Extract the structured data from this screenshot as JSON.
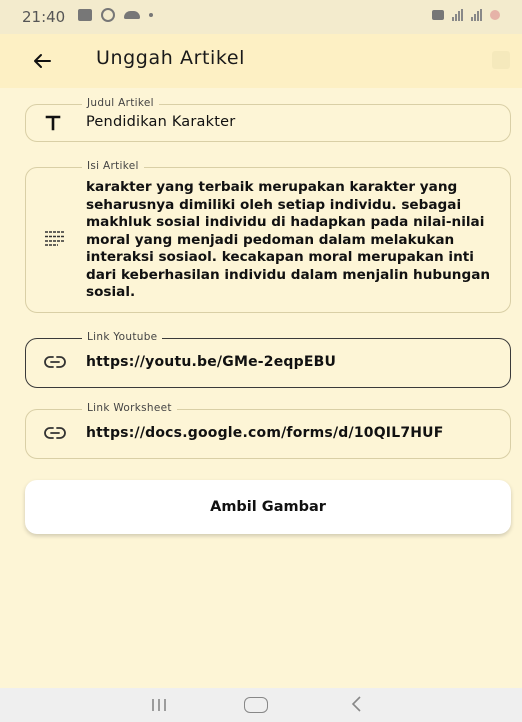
{
  "status_bar": {
    "time": "21:40",
    "icons": [
      "gallery-icon",
      "instagram-icon",
      "cloud-icon",
      "dot-icon",
      "vibrate-icon",
      "signal-icon",
      "signal-icon",
      "battery-icon"
    ]
  },
  "app_bar": {
    "title": "Unggah Artikel",
    "back_icon": "arrow-left-icon"
  },
  "form": {
    "title_field": {
      "label": "Judul Artikel",
      "value": "Pendidikan Karakter",
      "icon": "text-t-icon"
    },
    "content_field": {
      "label": "Isi Artikel",
      "value": "karakter yang terbaik merupakan karakter yang seharusnya dimiliki oleh setiap individu. sebagai makhluk sosial individu di hadapkan pada nilai-nilai moral yang menjadi pedoman dalam melakukan interaksi sosiaol. kecakapan moral merupakan inti dari keberhasilan individu dalam menjalin hubungan sosial.",
      "icon": "notes-icon"
    },
    "youtube_field": {
      "label": "Link Youtube",
      "value": "https://youtu.be/GMe-2eqpEBU",
      "icon": "link-icon"
    },
    "worksheet_field": {
      "label": "Link Worksheet",
      "value": "https://docs.google.com/forms/d/10QIL7HUF",
      "icon": "link-icon"
    },
    "take_photo_label": "Ambil Gambar"
  },
  "nav_bar": {
    "items": [
      "recent-apps-icon",
      "home-icon",
      "back-icon"
    ]
  },
  "colors": {
    "background": "#fdf5d6",
    "app_bar": "#fdf0c4",
    "field_border": "#d9cfa6",
    "active_border": "#3a3a3a",
    "button_bg": "#ffffff"
  }
}
